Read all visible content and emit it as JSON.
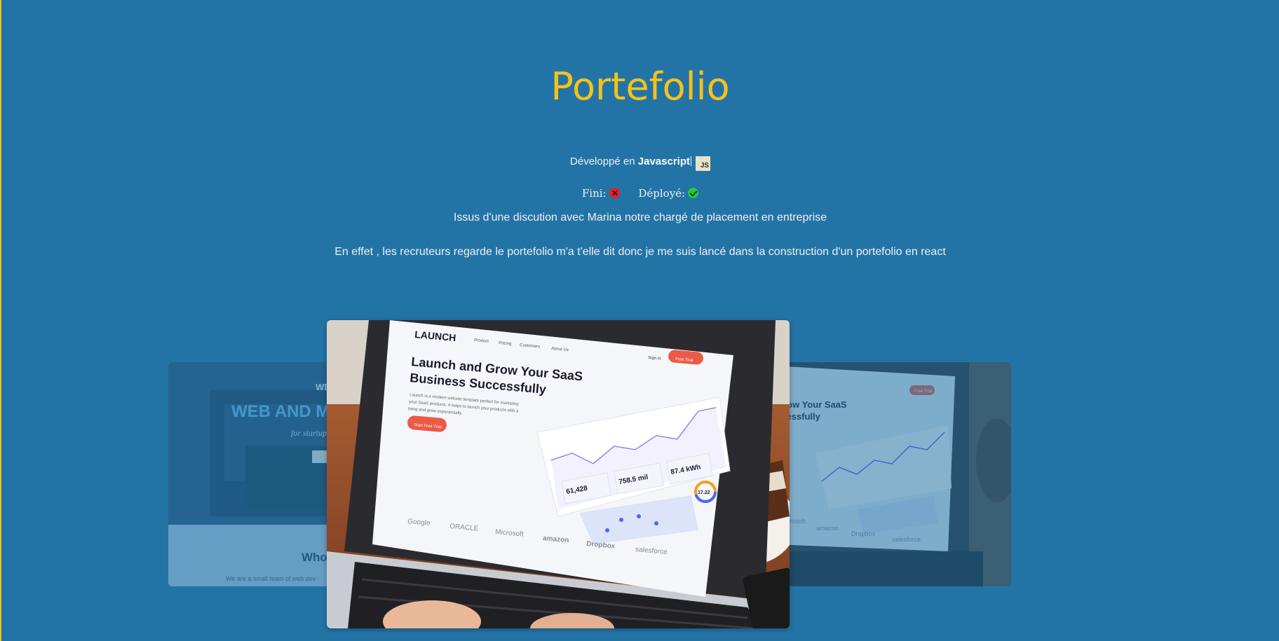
{
  "page": {
    "title": "Portefolio",
    "developed_prefix": "Développé en ",
    "language": "Javascript",
    "language_badge": "JS",
    "finished_label": "Fini:",
    "deployed_label": "Déployé:",
    "finished": false,
    "deployed": true,
    "description_1": "Issus d'une discution avec Marina notre chargé de placement en entreprise",
    "description_2": "En effet , les recruteurs regarde le portefolio m'a t'elle dit donc je me suis lancé dans la construction d'un portefolio en react"
  },
  "carousel": {
    "left_slide": {
      "tagline": "WE",
      "headline": "WEB AND M",
      "subline": "for startup",
      "section_title": "Who",
      "body_text": "We are a small team of web dev"
    },
    "center_slide": {
      "logo": "LAUNCH",
      "nav": [
        "Product",
        "Pricing",
        "Customers",
        "About Us"
      ],
      "sign_in": "Sign In",
      "cta": "Free Trial",
      "headline_1": "Launch and Grow Your SaaS",
      "headline_2": "Business Successfully",
      "body_1": "Launch is a modern website template perfect for marketing",
      "body_2": "your SaaS products. It helps to launch your products with a",
      "body_3": "bang and grow exponentially.",
      "hero_button": "Start Free Trial",
      "stats": [
        "61,428",
        "758.5 mil",
        "87.4 kWh",
        "17.22"
      ],
      "brands": [
        "Google",
        "ORACLE",
        "Microsoft",
        "amazon",
        "Dropbox",
        "salesforce"
      ]
    },
    "right_slide": {
      "headline_1": "Grow Your SaaS",
      "headline_2": "ccessfully",
      "brands": [
        "Microsoft",
        "amazon",
        "Dropbox",
        "salesforce"
      ],
      "cta": "Free Trial"
    }
  },
  "colors": {
    "background": "#2374a6",
    "title": "#f5c21a",
    "accent_border": "#f2c21a",
    "finished_dot": "#e8202a",
    "deployed_dot": "#28c840"
  }
}
